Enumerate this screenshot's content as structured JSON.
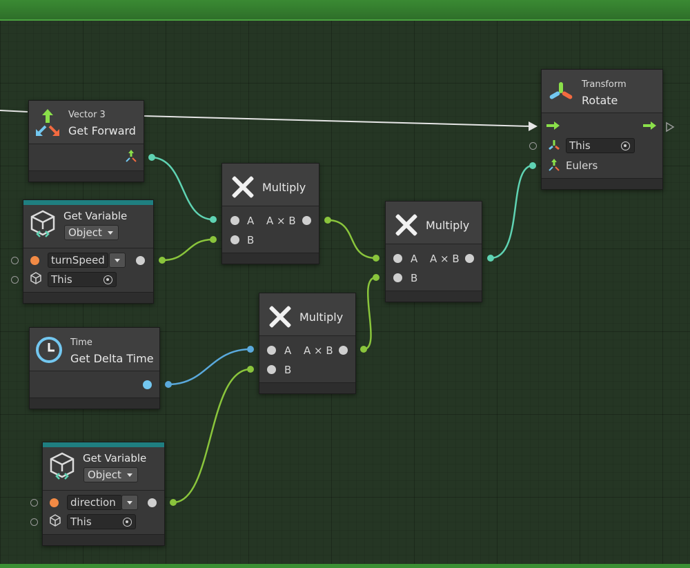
{
  "colors": {
    "background": "#253624",
    "node_body": "#383838",
    "wire_teal": "#5fd3b3",
    "wire_green": "#8ac53c",
    "wire_blue": "#5aa9dc",
    "control_flow": "#e6e6e6"
  },
  "nodes": {
    "get_forward": {
      "category": "Vector 3",
      "title": "Get Forward"
    },
    "get_variable_1": {
      "title": "Get Variable",
      "kind": "Object",
      "name": "turnSpeed",
      "target": "This"
    },
    "multiply_1": {
      "title": "Multiply",
      "in_a": "A",
      "in_b": "B",
      "out": "A × B"
    },
    "multiply_2": {
      "title": "Multiply",
      "in_a": "A",
      "in_b": "B",
      "out": "A × B"
    },
    "multiply_3": {
      "title": "Multiply",
      "in_a": "A",
      "in_b": "B",
      "out": "A × B"
    },
    "delta_time": {
      "category": "Time",
      "title": "Get Delta Time"
    },
    "get_variable_2": {
      "title": "Get Variable",
      "kind": "Object",
      "name": "direction",
      "target": "This"
    },
    "rotate": {
      "category": "Transform",
      "title": "Rotate",
      "target": "This",
      "eulers": "Eulers"
    }
  },
  "icons": {
    "axes": "transform-axes-icon",
    "variable": "variable-cube-icon",
    "clock": "clock-icon",
    "multiply": "multiply-x-icon",
    "rotate": "rotate-icon"
  }
}
